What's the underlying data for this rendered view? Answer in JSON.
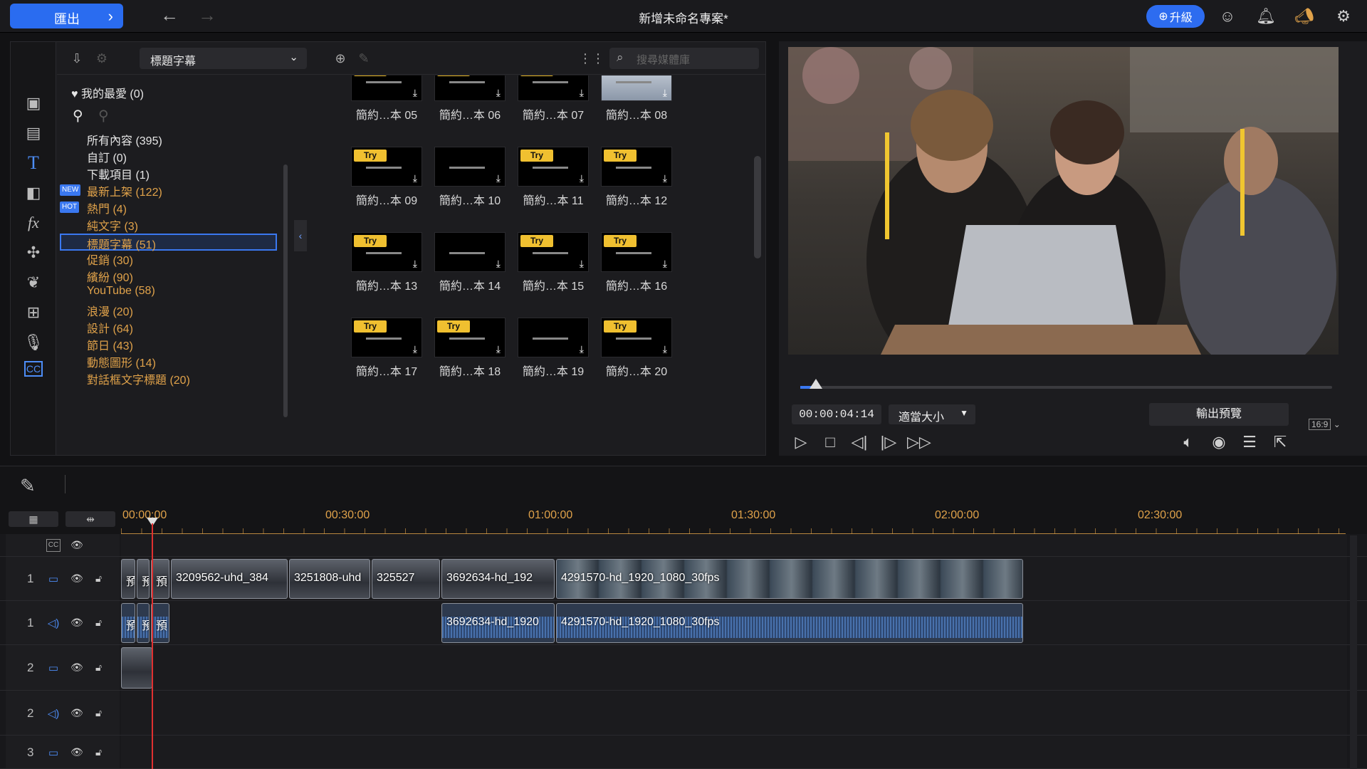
{
  "topbar": {
    "export_label": "匯出",
    "title": "新增未命名專案*",
    "upgrade_label": "升級"
  },
  "library": {
    "category_selected": "標題字幕",
    "search_placeholder": "搜尋媒體庫",
    "favorites_label": "我的最愛 (0)",
    "categories": [
      {
        "label": "所有內容 (395)"
      },
      {
        "label": "自訂 (0)"
      },
      {
        "label": "下載項目 (1)"
      },
      {
        "label": "最新上架 (122)",
        "tag": "NEW"
      },
      {
        "label": "熱門 (4)",
        "tag": "HOT"
      },
      {
        "label": "純文字 (3)"
      },
      {
        "label": "標題字幕 (51)"
      },
      {
        "label": "促銷 (30)"
      },
      {
        "label": "繽紛 (90)"
      },
      {
        "label": "YouTube (58)"
      },
      {
        "label": "浪漫 (20)"
      },
      {
        "label": "設計 (64)"
      },
      {
        "label": "節日 (43)"
      },
      {
        "label": "動態圖形 (14)"
      },
      {
        "label": "對話框文字標題 (20)"
      }
    ],
    "templates": [
      {
        "label": "簡約…本 05",
        "try": true
      },
      {
        "label": "簡約…本 06",
        "try": true
      },
      {
        "label": "簡約…本 07",
        "try": true
      },
      {
        "label": "簡約…本 08",
        "try": false
      },
      {
        "label": "簡約…本 09",
        "try": true
      },
      {
        "label": "簡約…本 10",
        "try": false
      },
      {
        "label": "簡約…本 11",
        "try": true
      },
      {
        "label": "簡約…本 12",
        "try": true
      },
      {
        "label": "簡約…本 13",
        "try": true
      },
      {
        "label": "簡約…本 14",
        "try": false
      },
      {
        "label": "簡約…本 15",
        "try": true
      },
      {
        "label": "簡約…本 16",
        "try": true
      },
      {
        "label": "簡約…本 17",
        "try": true
      },
      {
        "label": "簡約…本 18",
        "try": true
      },
      {
        "label": "簡約…本 19",
        "try": false
      },
      {
        "label": "簡約…本 20",
        "try": true
      }
    ],
    "try_label": "Try"
  },
  "preview": {
    "timecode": "00:00:04:14",
    "fit_label": "適當大小",
    "output_preview_label": "輸出預覽",
    "aspect_label": "16:9",
    "scrub_progress": 0.03
  },
  "timeline": {
    "ruler_labels": [
      "00:00:00",
      "00:30:00",
      "01:00:00",
      "01:30:00",
      "02:00:00",
      "02:30:00"
    ],
    "tracks": [
      {
        "num": "",
        "type": "cc"
      },
      {
        "num": "1",
        "type": "video"
      },
      {
        "num": "1",
        "type": "audio"
      },
      {
        "num": "2",
        "type": "video"
      },
      {
        "num": "2",
        "type": "audio"
      },
      {
        "num": "3",
        "type": "video"
      }
    ],
    "video_clips": [
      "預",
      "預",
      "預",
      "3209562-uhd_384",
      "3251808-uhd",
      "325527",
      "3692634-hd_192",
      "4291570-hd_1920_1080_30fps"
    ],
    "audio_clips": [
      "預",
      "預",
      "預",
      "3692634-hd_1920",
      "4291570-hd_1920_1080_30fps"
    ]
  },
  "colors": {
    "accent": "#2a6cf0",
    "category_text": "#e0a24a",
    "try_badge": "#f0c030",
    "playhead": "#e03030"
  }
}
